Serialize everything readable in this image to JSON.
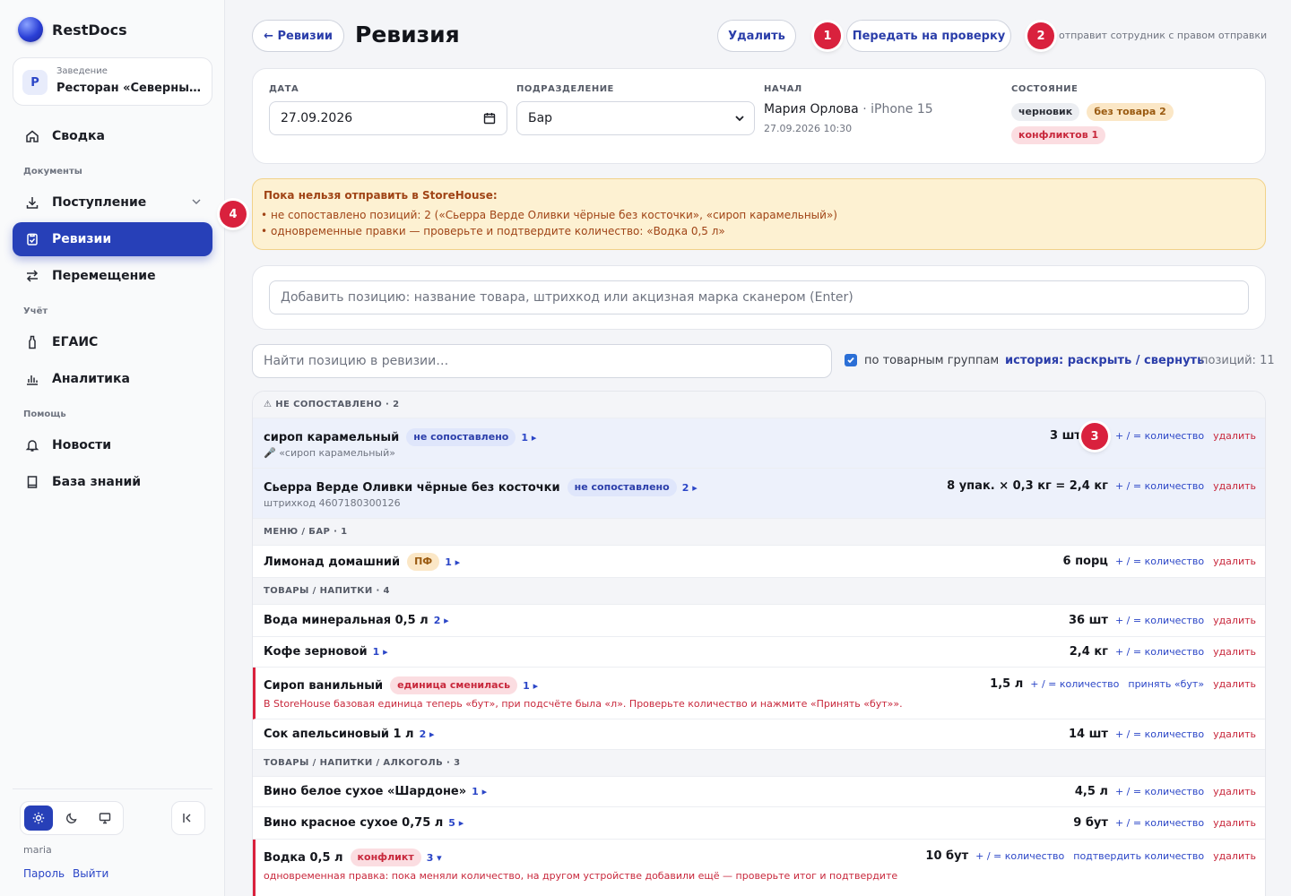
{
  "sidebar": {
    "brand": "RestDocs",
    "venue": {
      "label": "Заведение",
      "avatar": "Р",
      "name": "Ресторан «Северный ..."
    },
    "items": [
      {
        "label": "Сводка",
        "icon": "home-icon"
      },
      {
        "label": "Поступление",
        "icon": "download-icon"
      },
      {
        "label": "Ревизии",
        "icon": "clipboard-check-icon"
      },
      {
        "label": "Перемещение",
        "icon": "transfer-icon"
      },
      {
        "label": "ЕГАИС",
        "icon": "bottle-icon"
      },
      {
        "label": "Аналитика",
        "icon": "bar-chart-icon"
      },
      {
        "label": "Новости",
        "icon": "bell-icon"
      },
      {
        "label": "База знаний",
        "icon": "book-icon"
      }
    ],
    "sections": {
      "documents": "Документы",
      "accounting": "Учёт",
      "help": "Помощь"
    },
    "user": {
      "login": "maria",
      "password_link": "Пароль",
      "logout_link": "Выйти"
    }
  },
  "header": {
    "back_label": "← Ревизии",
    "title": "Ревизия",
    "delete_label": "Удалить",
    "submit_label": "Передать на проверку",
    "hint": "отправит сотрудник с правом отправки",
    "badges": [
      "1",
      "2",
      "3",
      "4"
    ]
  },
  "info": {
    "date_label": "ДАТА",
    "date_value": "27.09.2026",
    "dept_label": "ПОДРАЗДЕЛЕНИЕ",
    "dept_value": "Бар",
    "started_label": "НАЧАЛ",
    "started_name": "Мария Орлова",
    "started_device": "· iPhone 15",
    "started_time": "27.09.2026 10:30",
    "state_label": "СОСТОЯНИЕ",
    "chips": {
      "draft": "черновик",
      "no_goods": "без товара 2",
      "conflicts": "конфликтов 1"
    }
  },
  "warning": {
    "title": "Пока нельзя отправить в StoreHouse:",
    "items": [
      "не сопоставлено позиций: 2 («Сьерра Верде Оливки чёрные без косточки», «сироп карамельный»)",
      "одновременные правки — проверьте и подтвердите количество: «Водка 0,5 л»"
    ]
  },
  "add_position": {
    "placeholder": "Добавить позицию: название товара, штрихкод или акцизная марка сканером (Enter)"
  },
  "toolbar": {
    "search_placeholder": "Найти позицию в ревизии…",
    "group_label": "по товарным группам",
    "history_label": "история:",
    "expand_label": "раскрыть",
    "sep": "/",
    "collapse_label": "свернуть",
    "count_label": "позиций: 11"
  },
  "table": {
    "qty_link": "+ / = количество",
    "delete_link": "удалить",
    "accept_unit": "принять «бут»",
    "confirm_qty": "подтвердить количество",
    "groups": [
      {
        "label": "⚠ НЕ СОПОСТАВЛЕНО · 2"
      },
      {
        "label": "МЕНЮ / БАР · 1"
      },
      {
        "label": "ТОВАРЫ / НАПИТКИ · 4"
      },
      {
        "label": "ТОВАРЫ / НАПИТКИ / АЛКОГОЛЬ · 3"
      }
    ],
    "rows": [
      {
        "name": "сироп карамельный",
        "chip": "не сопоставлено",
        "hist": "1 ▸",
        "sub": "🎤 «сироп карамельный»",
        "qty": "3 шт"
      },
      {
        "name": "Сьерра Верде Оливки чёрные без косточки",
        "chip": "не сопоставлено",
        "hist": "2 ▸",
        "sub": "штрихкод 4607180300126",
        "qty": "8 упак. × 0,3 кг = 2,4 кг"
      },
      {
        "name": "Лимонад домашний",
        "chip": "ПФ",
        "hist": "1 ▸",
        "qty": "6 порц"
      },
      {
        "name": "Вода минеральная 0,5 л",
        "hist": "2 ▸",
        "qty": "36 шт"
      },
      {
        "name": "Кофе зерновой",
        "hist": "1 ▸",
        "qty": "2,4 кг"
      },
      {
        "name": "Сироп ванильный",
        "chip": "единица сменилась",
        "hist": "1 ▸",
        "sub": "В StoreHouse базовая единица теперь «бут», при подсчёте была «л». Проверьте количество и нажмите «Принять «бут»».",
        "qty": "1,5 л"
      },
      {
        "name": "Сок апельсиновый 1 л",
        "hist": "2 ▸",
        "qty": "14 шт"
      },
      {
        "name": "Вино белое сухое «Шардоне»",
        "hist": "1 ▸",
        "qty": "4,5 л"
      },
      {
        "name": "Вино красное сухое 0,75 л",
        "hist": "5 ▸",
        "qty": "9 бут"
      },
      {
        "name": "Водка 0,5 л",
        "chip": "конфликт",
        "hist": "3 ▾",
        "sub": "одновременная правка: пока меняли количество, на другом устройстве добавили ещё — проверьте итог и подтвердите",
        "qty": "10 бут"
      }
    ]
  }
}
